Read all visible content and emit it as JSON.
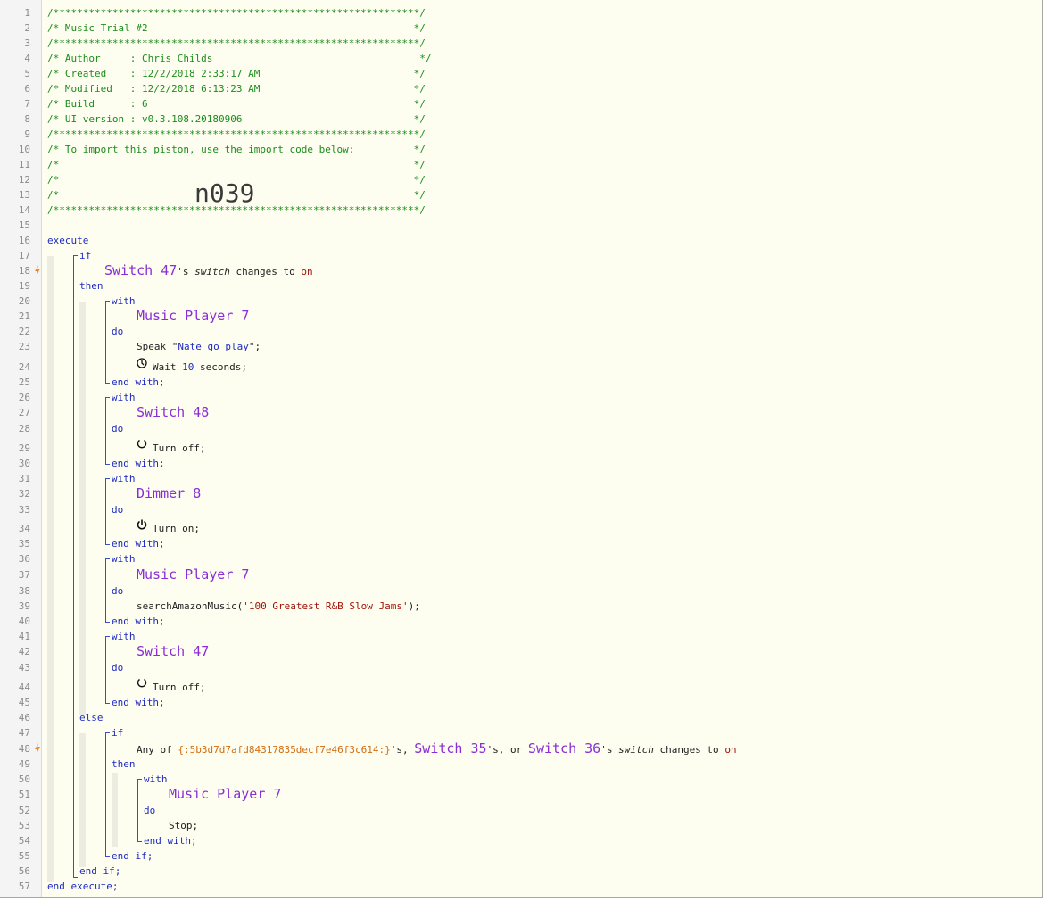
{
  "import_code": "n039",
  "header_comment": [
    "/**************************************************************/",
    "/* Music Trial #2                                             */",
    "/**************************************************************/",
    "/* Author     : Chris Childs                                   */",
    "/* Created    : 12/2/2018 2:33:17 AM                          */",
    "/* Modified   : 12/2/2018 6:13:23 AM                          */",
    "/* Build      : 6                                             */",
    "/* UI version : v0.3.108.20180906                             */",
    "/**************************************************************/",
    "/* To import this piston, use the import code below:          */",
    "/*                                                            */",
    "/*                                                            */",
    "/*                                                            */",
    "/**************************************************************/"
  ],
  "kw": {
    "execute": "execute",
    "end_execute": "end execute;",
    "if": "if",
    "then": "then",
    "else": "else",
    "end_if": "end if;",
    "with": "with",
    "do": "do",
    "end_with": "end with;"
  },
  "trigger1": {
    "device": "Switch 47",
    "possessive": "'s ",
    "attribute": "switch",
    "verb": " changes to ",
    "value": "on"
  },
  "blocks": {
    "mp7_a": {
      "device": "Music Player 7",
      "speak_cmd": "Speak \"",
      "speak_text": "Nate go play",
      "speak_end": "\";",
      "wait_cmd": "Wait ",
      "wait_num": "10",
      "wait_end": " seconds;"
    },
    "sw48": {
      "device": "Switch 48",
      "cmd": "Turn off;"
    },
    "dim8": {
      "device": "Dimmer 8",
      "cmd": "Turn on;"
    },
    "mp7_b": {
      "device": "Music Player 7",
      "cmd_pre": "searchAmazonMusic(",
      "arg": "'100 Greatest R&B Slow Jams'",
      "cmd_post": ");"
    },
    "sw47": {
      "device": "Switch 47",
      "cmd": "Turn off;"
    }
  },
  "trigger2": {
    "prefix": "Any of ",
    "var": "{:5b3d7d7afd84317835decf7e46f3c614:}",
    "sep1": "'s, ",
    "dev1": "Switch 35",
    "sep2": "'s, or ",
    "dev2": "Switch 36",
    "possessive": "'s ",
    "attribute": "switch",
    "verb": " changes to ",
    "value": "on"
  },
  "else_block": {
    "device": "Music Player 7",
    "cmd": "Stop;"
  },
  "colors": {
    "comment": "#1c8d1c",
    "keyword": "#1f2cc2",
    "device": "#8a2ed6",
    "literal": "#a0140a",
    "variable": "#d06d12",
    "bolt": "#f08a24"
  }
}
